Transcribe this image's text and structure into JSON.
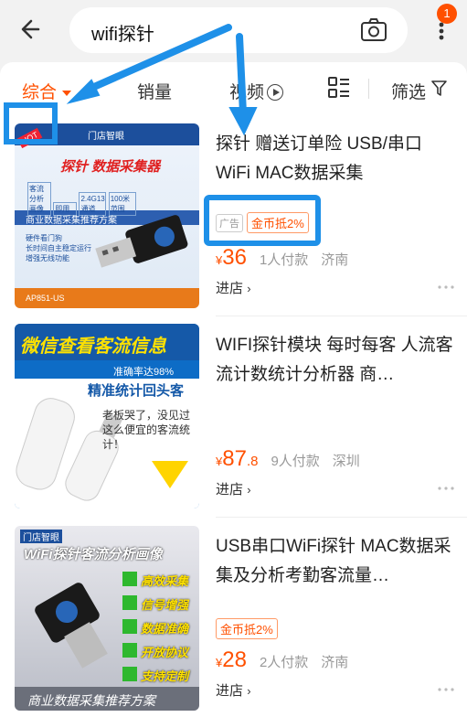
{
  "header": {
    "search_text": "wifi探针",
    "notification_count": "1"
  },
  "sortbar": {
    "items": [
      "综合",
      "销量",
      "视频",
      "筛选"
    ]
  },
  "products": [
    {
      "title": "探针 赠送订单险 USB/串口WiFi MAC数据采集",
      "ad_tag": "广告",
      "coin_tag": "金币抵2%",
      "yen": "¥",
      "price": "36",
      "price_decimal": "",
      "paid": "1人付款",
      "city": "济南",
      "shop": "进店",
      "thumb": {
        "hot": "HOT",
        "brand": "门店智眼",
        "headline": "探针 数据采集器",
        "cells": [
          "客流分析画像",
          "即用",
          "2.4G13通道",
          "100米范围"
        ],
        "subtitle": "商业数据采集推荐方案",
        "lines": [
          "硬件看门狗",
          "长时间自主稳定运行",
          "增强无线功能"
        ],
        "model": "AP851-US"
      }
    },
    {
      "title": "WIFI探针模块 每时每客 人流客流计数统计分析器 商…",
      "ad_tag": "",
      "coin_tag": "",
      "yen": "¥",
      "price": "87",
      "price_decimal": ".8",
      "paid": "9人付款",
      "city": "深圳",
      "shop": "进店",
      "thumb": {
        "banner": "微信查看客流信息",
        "accuracy": "准确率达98%",
        "headline": "精准统计回头客",
        "bubble": "老板哭了，没见过这么便宜的客流统计！"
      }
    },
    {
      "title": "USB串口WiFi探针 MAC数据采集及分析考勤客流量…",
      "ad_tag": "",
      "coin_tag": "金币抵2%",
      "yen": "¥",
      "price": "28",
      "price_decimal": "",
      "paid": "2人付款",
      "city": "济南",
      "shop": "进店",
      "thumb": {
        "brand": "门店智眼",
        "headline": "WiFi探针客流分析画像",
        "features": [
          "高效采集",
          "信号增强",
          "数据准确",
          "开放协议",
          "支持定制"
        ],
        "footer": "商业数据采集推荐方案"
      }
    }
  ],
  "colors": {
    "accent": "#ff5000",
    "annotation": "#1e90e8"
  }
}
